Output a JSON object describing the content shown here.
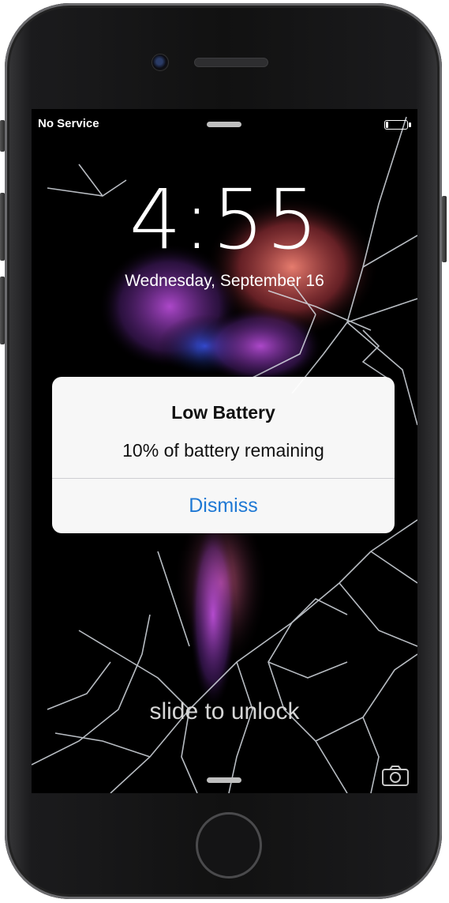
{
  "status_bar": {
    "carrier": "No Service",
    "battery_level": 0.1
  },
  "lock_screen": {
    "time": "4:55",
    "date": "Wednesday, September 16",
    "unlock_hint": "slide to unlock"
  },
  "alert": {
    "title": "Low Battery",
    "message": "10% of battery remaining",
    "dismiss_label": "Dismiss"
  },
  "colors": {
    "accent": "#1e78d4",
    "alert_bg": "#ffffff",
    "screen_bg": "#000000"
  },
  "icons": {
    "camera": "camera-icon",
    "front_camera": "front-camera",
    "home": "home-button"
  }
}
